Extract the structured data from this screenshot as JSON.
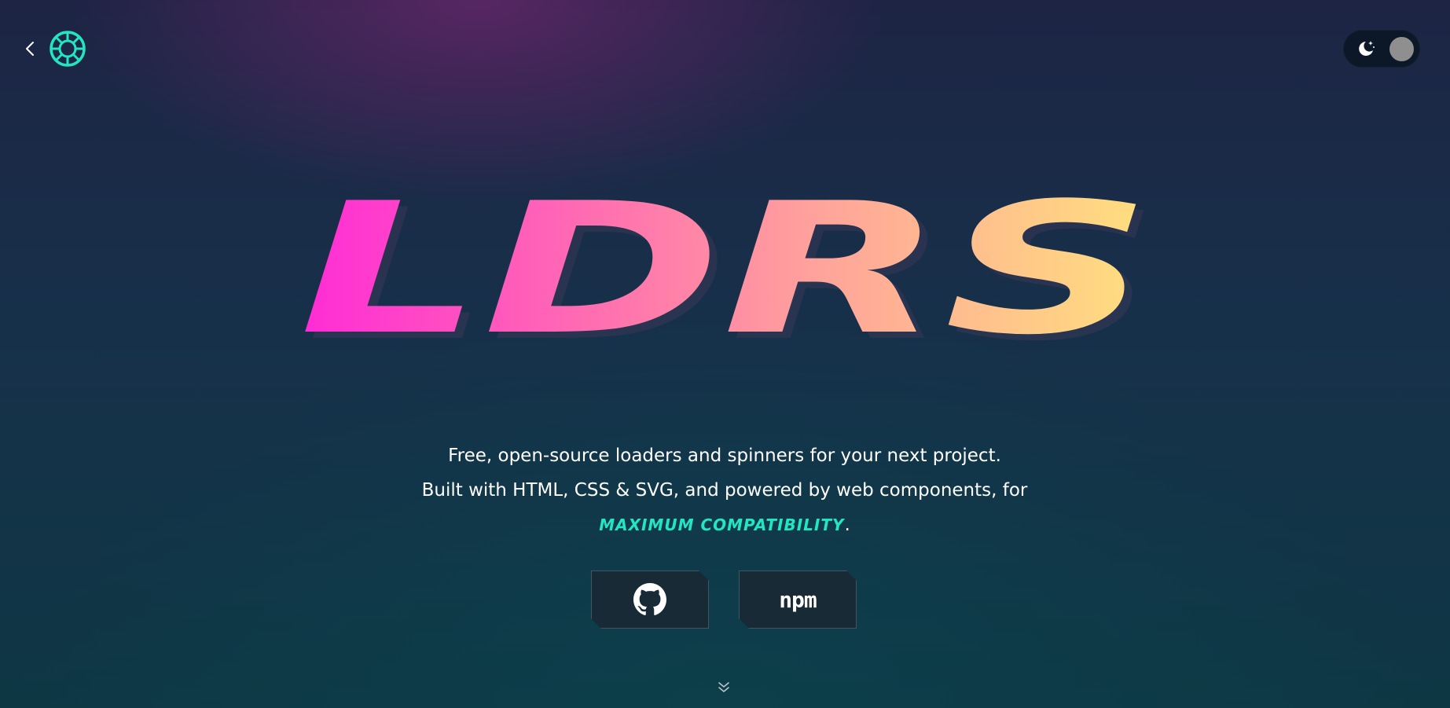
{
  "header": {
    "back_icon": "chevron-left-icon",
    "logo_icon": "ldrs-logo-icon"
  },
  "theme_toggle": {
    "icon": "moon-stars-icon",
    "state": "dark"
  },
  "hero": {
    "title": "LDRS",
    "gradient_colors": [
      "#ff2bd6",
      "#ff6fb0",
      "#ffa59a",
      "#ffe07e"
    ]
  },
  "tagline": {
    "line1": "Free, open-source loaders and spinners for your next project.",
    "line2": "Built with HTML, CSS & SVG, and powered by web components, for",
    "highlight": "maximum compatibility",
    "suffix": "."
  },
  "buttons": {
    "github_icon": "github-icon",
    "npm_label": "npm"
  },
  "scroll_hint": {
    "icon": "double-chevron-down-icon"
  },
  "colors": {
    "accent": "#22e6c2",
    "background_top": "#1d2444",
    "background_bottom": "#0e3744",
    "button_bg": "#172a35"
  }
}
